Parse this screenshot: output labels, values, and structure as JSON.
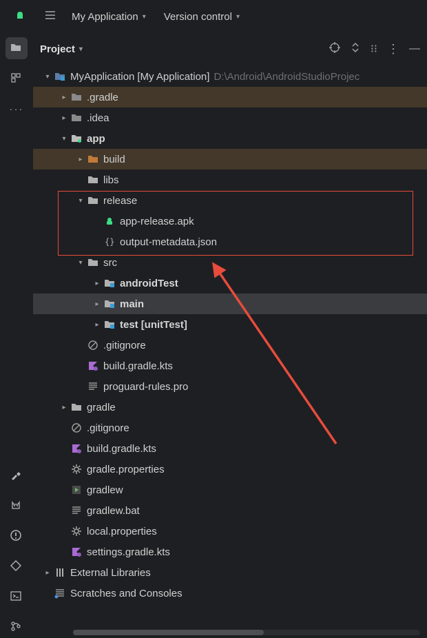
{
  "topbar": {
    "app_menu": "My Application",
    "vcs_menu": "Version control"
  },
  "panel": {
    "title": "Project"
  },
  "tree": {
    "root": {
      "label": "MyApplication",
      "suffix": "[My Application]",
      "path": "D:\\Android\\AndroidStudioProjec"
    },
    "gradle_dir": ".gradle",
    "idea_dir": ".idea",
    "app": "app",
    "build": "build",
    "libs": "libs",
    "release": "release",
    "apk": "app-release.apk",
    "output_meta": "output-metadata.json",
    "src": "src",
    "android_test": "androidTest",
    "main": "main",
    "test": "test",
    "test_suffix": "[unitTest]",
    "gitignore1": ".gitignore",
    "build_gradle1": "build.gradle.kts",
    "proguard": "proguard-rules.pro",
    "gradle2": "gradle",
    "gitignore2": ".gitignore",
    "build_gradle2": "build.gradle.kts",
    "gradle_props": "gradle.properties",
    "gradlew": "gradlew",
    "gradlew_bat": "gradlew.bat",
    "local_props": "local.properties",
    "settings_gradle": "settings.gradle.kts",
    "ext_libs": "External Libraries",
    "scratches": "Scratches and Consoles"
  }
}
